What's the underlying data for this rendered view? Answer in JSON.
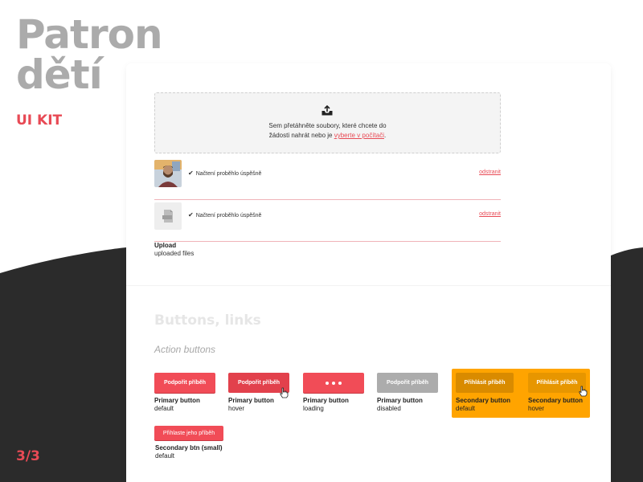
{
  "brand": {
    "title_line1": "Patron",
    "title_line2": "dětí",
    "subtitle": "UI KIT",
    "page_number": "3/3"
  },
  "colors": {
    "accent": "#e84a55",
    "dark_bg": "#2b2b2b",
    "secondary": "#ffa400",
    "disabled": "#acacac"
  },
  "upload": {
    "dropzone_text": "Sem přetáhněte soubory, které chcete do",
    "dropzone_text2": "žádosti nahrát nebo je",
    "dropzone_link": "vyberte v počítači",
    "dropzone_end": ".",
    "files": [
      {
        "status": "Načtení proběhlo úspěšně",
        "remove": "odstranit",
        "thumb_icon": "photo-thumbnail"
      },
      {
        "status": "Načtení proběhlo úspěšně",
        "remove": "odstranit",
        "thumb_icon": "pdf-file-icon"
      }
    ],
    "caption_title": "Upload",
    "caption_sub": "uploaded files"
  },
  "buttons_section": {
    "title": "Buttons, links",
    "subtitle": "Action buttons",
    "items": [
      {
        "label": "Podpořit příběh",
        "name": "Primary button",
        "state": "default"
      },
      {
        "label": "Podpořit příběh",
        "name": "Primary button",
        "state": "hover"
      },
      {
        "label": "",
        "name": "Primary button",
        "state": "loading"
      },
      {
        "label": "Podpořit příběh",
        "name": "Primary button",
        "state": "disabled"
      },
      {
        "label": "Přihlásit příběh",
        "name": "Secondary button",
        "state": "default"
      },
      {
        "label": "Přihlásit příběh",
        "name": "Secondary button",
        "state": "hover"
      }
    ],
    "small": {
      "label": "Přihlaste jeho příběh",
      "name": "Secondary btn (small)",
      "state": "default"
    }
  }
}
